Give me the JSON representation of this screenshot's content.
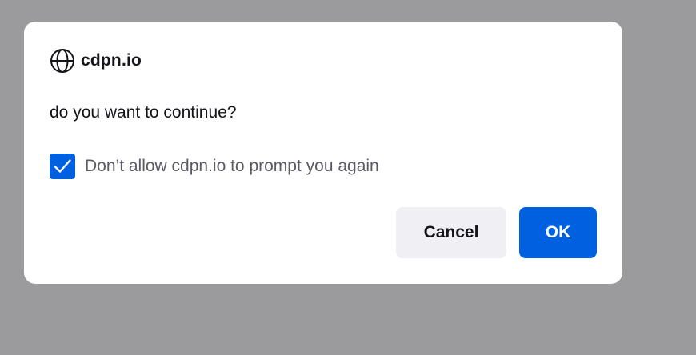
{
  "dialog": {
    "origin": "cdpn.io",
    "origin_icon": "globe-icon",
    "message": "do you want to continue?",
    "checkbox": {
      "label": "Don’t allow cdpn.io to prompt you again",
      "checked": true,
      "color": "#0061e0"
    },
    "cancel_label": "Cancel",
    "ok_label": "OK"
  }
}
